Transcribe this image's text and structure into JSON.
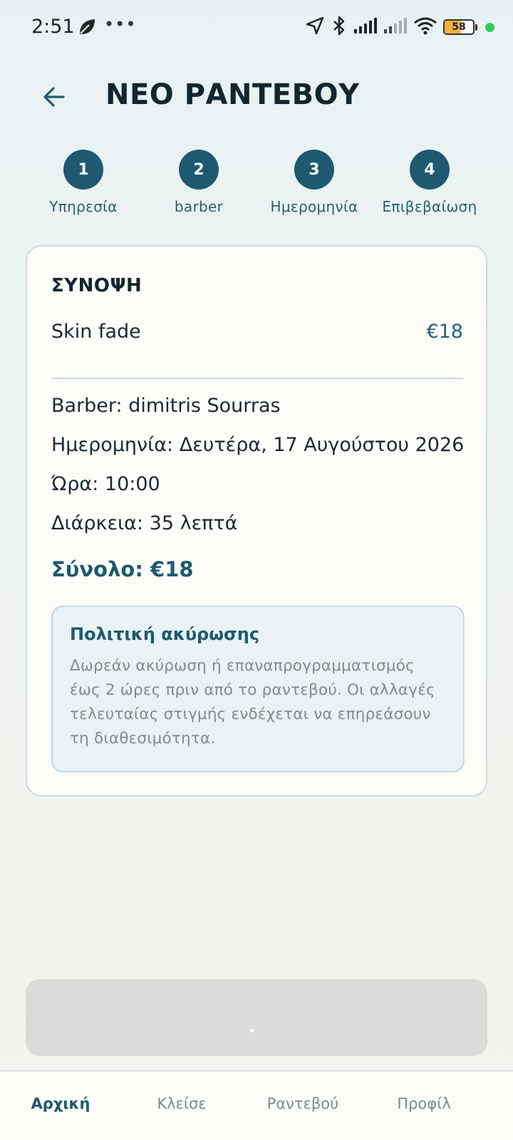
{
  "status_bar": {
    "time": "2:51",
    "battery": "58",
    "battery_level": 0.58,
    "icons": [
      "leaf-icon",
      "more-dots-icon",
      "location-icon",
      "bluetooth-icon",
      "signal-icon",
      "signal-weak-icon",
      "wifi-icon",
      "battery-icon"
    ]
  },
  "header": {
    "title": "ΝΕΟ ΡΑΝΤΕΒΟΥ",
    "back_icon": "arrow-left-icon"
  },
  "stepper": {
    "steps": [
      {
        "number": "1",
        "label": "Υπηρεσία"
      },
      {
        "number": "2",
        "label": "barber"
      },
      {
        "number": "3",
        "label": "Ημερομηνία"
      },
      {
        "number": "4",
        "label": "Επιβεβαίωση"
      }
    ]
  },
  "summary": {
    "title": "ΣΥΝΟΨΗ",
    "service_name": "Skin fade",
    "service_price": "€18",
    "barber": "Barber: dimitris Sourras",
    "date": "Ημερομηνία: Δευτέρα, 17 Αυγούστου 2026",
    "time": "Ώρα: 10:00",
    "duration": "Διάρκεια: 35 λεπτά",
    "total": "Σύνολο: €18"
  },
  "policy": {
    "title": "Πολιτική ακύρωσης",
    "text": "Δωρεάν ακύρωση ή επαναπρογραμματισμός έως 2 ώρες πριν από το ραντεβού. Οι αλλαγές τελευταίας στιγμής ενδέχεται να επηρεάσουν τη διαθεσιμότητα."
  },
  "bottom_nav": {
    "items": [
      {
        "label": "Αρχική",
        "active": true
      },
      {
        "label": "Κλείσε",
        "active": false
      },
      {
        "label": "Ραντεβού",
        "active": false
      },
      {
        "label": "Προφίλ",
        "active": false
      }
    ]
  },
  "colors": {
    "primary": "#1e5970",
    "card_bg": "#fdfcf8",
    "policy_bg": "#e9f2f4",
    "button_disabled": "#d9dcd9"
  }
}
